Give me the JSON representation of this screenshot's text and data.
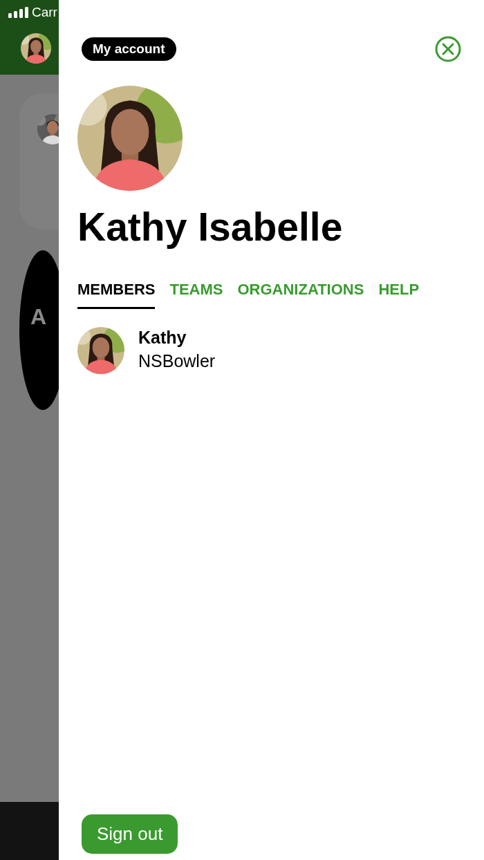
{
  "status_bar": {
    "carrier": "Carr"
  },
  "background": {
    "cards": [
      {
        "kind": "picture"
      },
      {
        "kind": "letter",
        "letter": "A"
      }
    ]
  },
  "account": {
    "badge": "My account",
    "name": "Kathy Isabelle",
    "tabs": [
      {
        "label": "MEMBERS",
        "selected": true
      },
      {
        "label": "TEAMS",
        "selected": false
      },
      {
        "label": "ORGANIZATIONS",
        "selected": false
      },
      {
        "label": "HELP",
        "selected": false
      }
    ],
    "members": [
      {
        "name": "Kathy",
        "username": "NSBowler"
      }
    ],
    "sign_out": "Sign out"
  }
}
